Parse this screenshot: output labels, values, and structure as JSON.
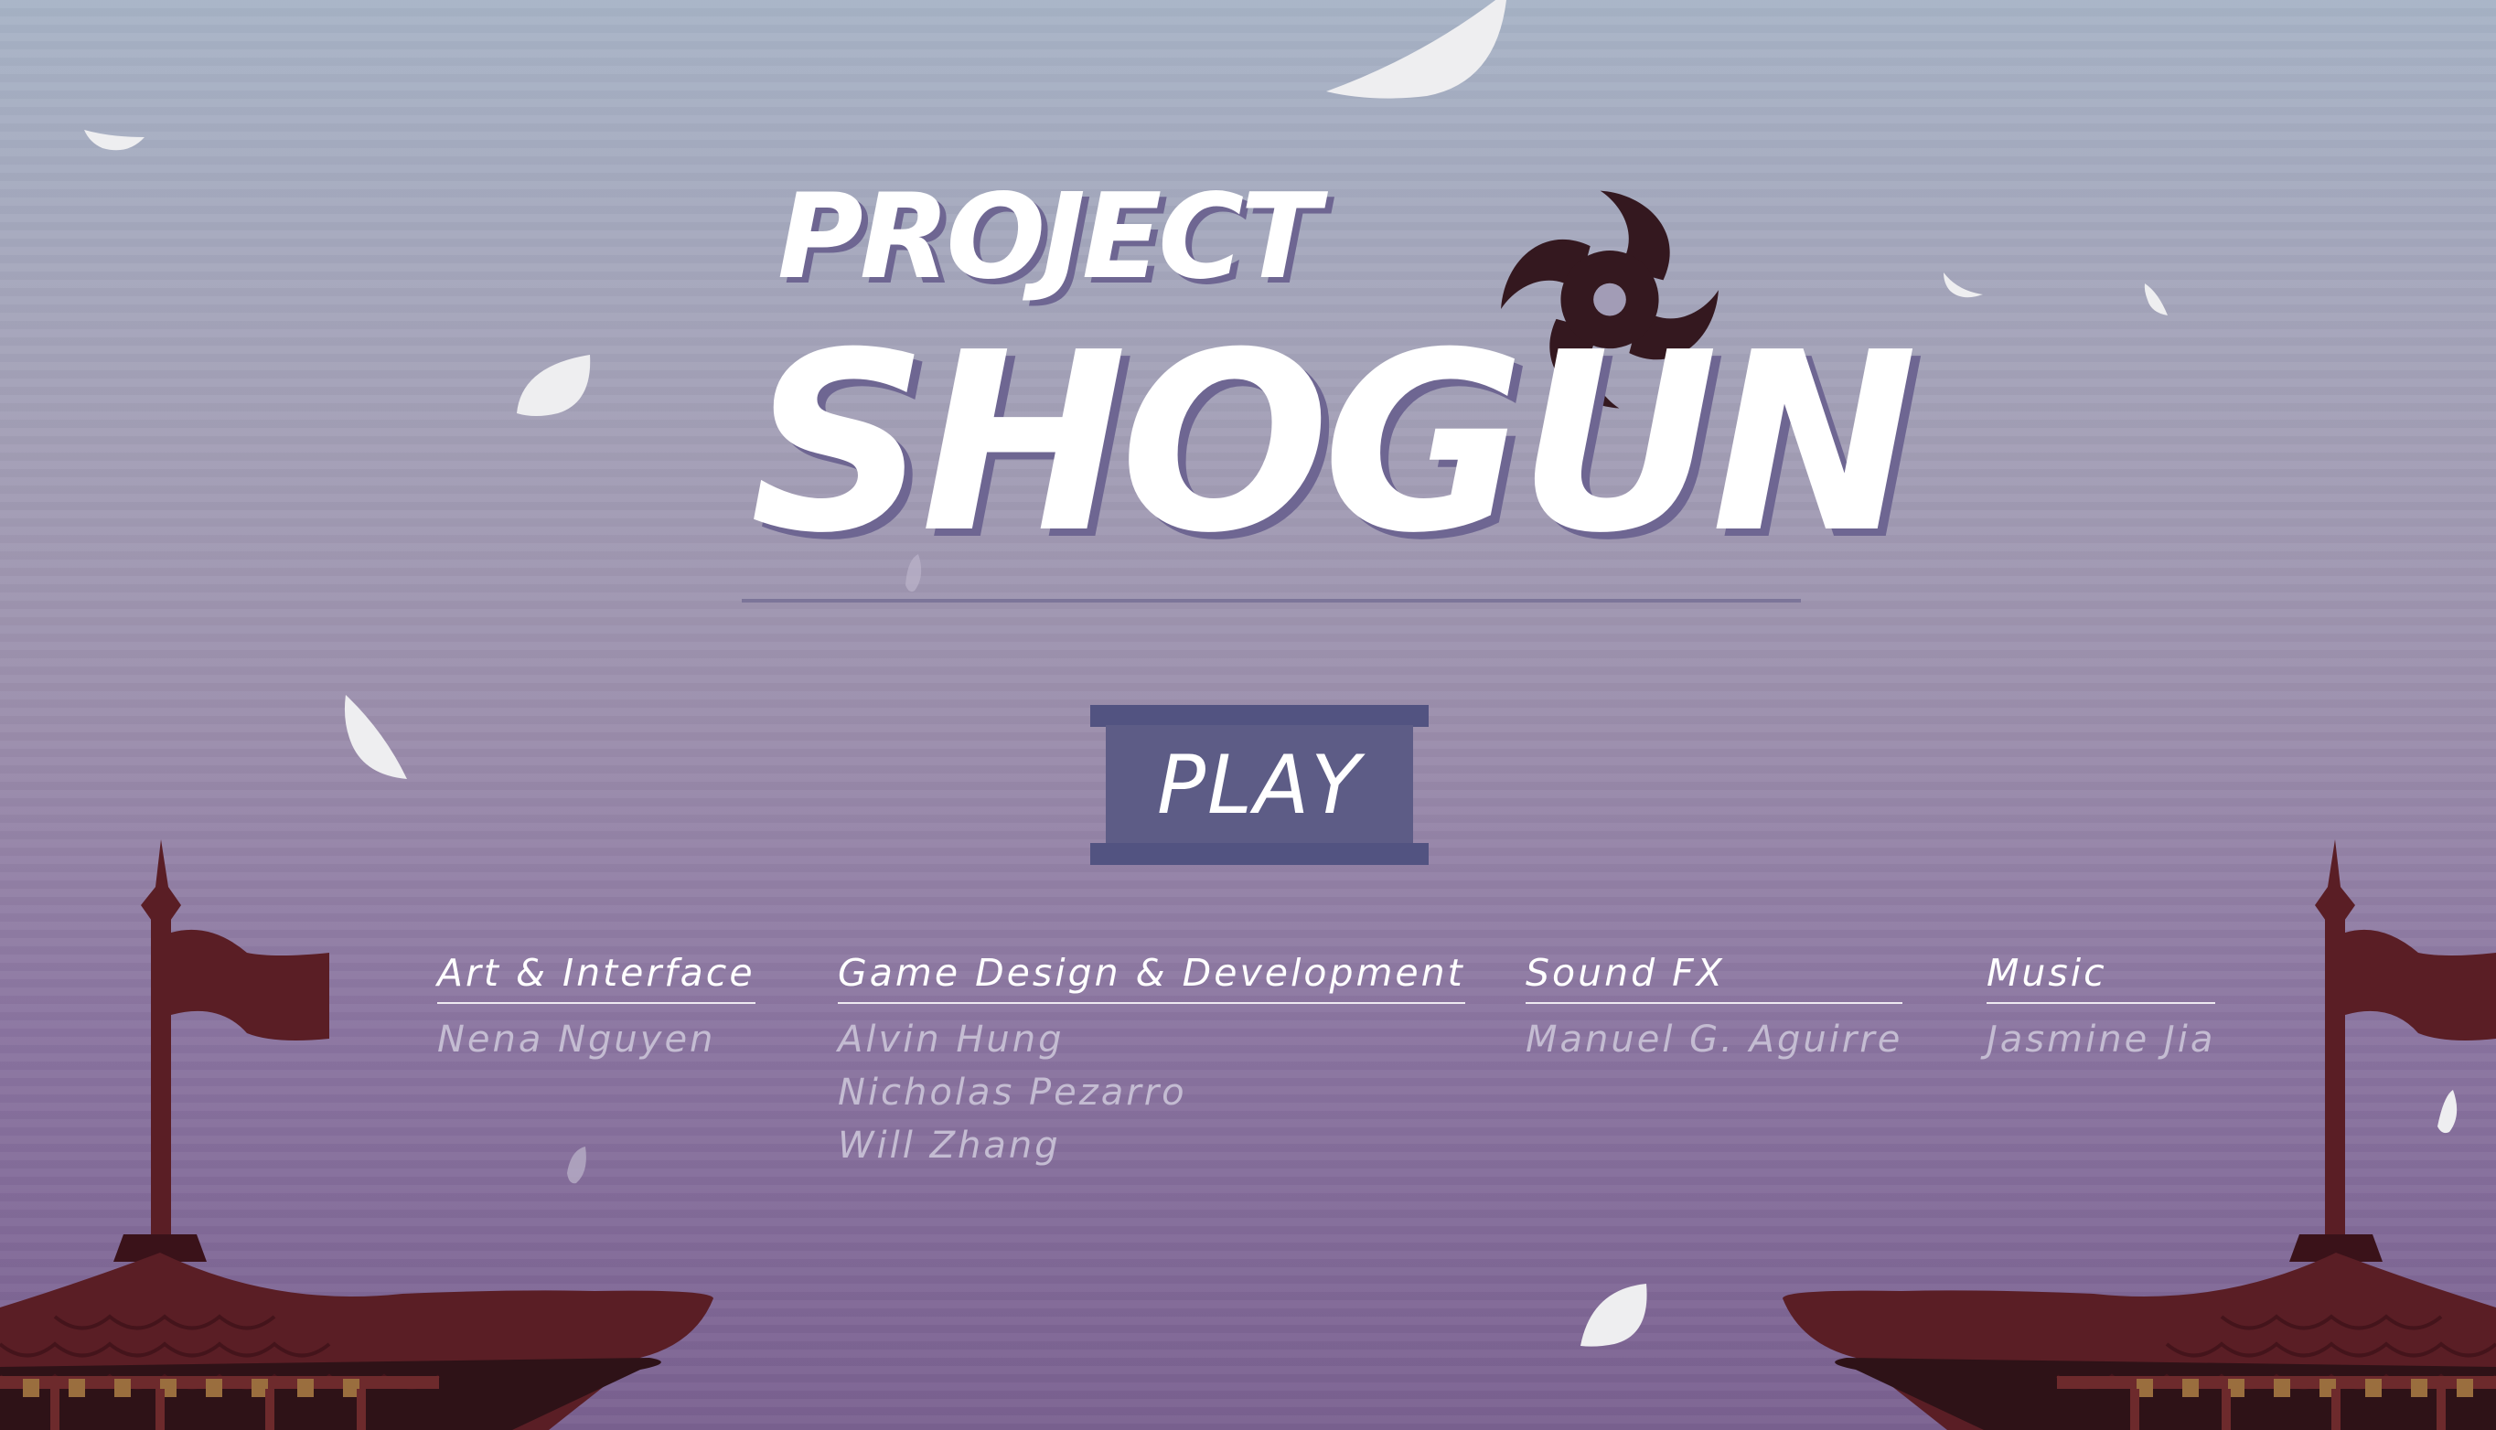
{
  "title": {
    "line1": "PROJECT",
    "line2": "SHOGUN"
  },
  "play_button": {
    "label": "PLAY"
  },
  "credits": [
    {
      "role": "Art & Interface",
      "names": [
        "Nena Nguyen"
      ]
    },
    {
      "role": "Game Design & Development",
      "names": [
        "Alvin Hung",
        "Nicholas Pezarro",
        "Will Zhang"
      ]
    },
    {
      "role": "Sound FX",
      "names": [
        "Manuel G. Aguirre"
      ]
    },
    {
      "role": "Music",
      "names": [
        "Jasmine Jia"
      ]
    }
  ],
  "colors": {
    "roof": "#5a1e25",
    "roof_dark": "#3a1219",
    "shuriken": "#34181f",
    "petal": "#e3e3e6",
    "button": "#5d5c86",
    "button_cap": "#525381"
  },
  "icons": [
    "shuriken-icon",
    "pagoda-roof-left",
    "pagoda-roof-right",
    "cherry-petal"
  ]
}
